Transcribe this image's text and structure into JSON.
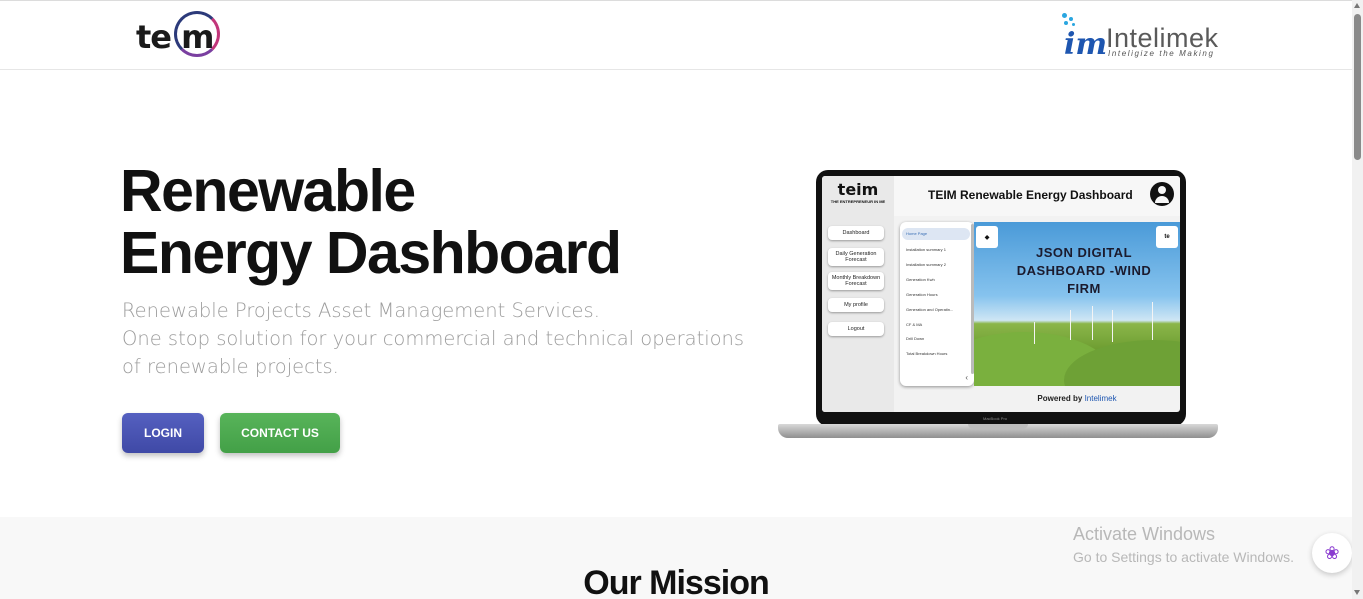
{
  "header": {
    "teim_logo_text": "te m",
    "intelimek": {
      "mark": "im",
      "name": "Intelimek",
      "tagline": "Inteligize the Making"
    }
  },
  "hero": {
    "title_line1": "Renewable",
    "title_line2": "Energy Dashboard",
    "subtitle_line1": "Renewable Projects Asset Management Services.",
    "subtitle_line2": "One stop solution for your commercial and technical operations",
    "subtitle_line3": "of renewable projects.",
    "login_label": "LOGIN",
    "contact_label": "CONTACT US"
  },
  "dashboard_preview": {
    "logo": "teim",
    "logo_sub": "THE ENTREPRENEUR IN ME",
    "title": "TEIM Renewable Energy Dashboard",
    "nav": [
      "Dashboard",
      "Daily Generation Forecast",
      "Monthly Breakdown Forecast",
      "My profile",
      "Logout"
    ],
    "list": [
      "Home Page",
      "Installation summary 1",
      "Installation summary 2",
      "Generation Kwh",
      "Generation Hours",
      "Generation and Operatin...",
      "CF & MA",
      "Drill Down",
      "Total Breakdown Hours"
    ],
    "banner": "JSON DIGITAL DASHBOARD -WIND FIRM",
    "powered_by": "Powered by",
    "powered_brand": "Intelimek",
    "laptop_model": "MacBook Pro"
  },
  "mission": {
    "title": "Our Mission"
  },
  "windows": {
    "line1": "Activate Windows",
    "line2": "Go to Settings to activate Windows."
  },
  "colors": {
    "login": "#3f49a6",
    "contact": "#43a047",
    "accent_blue": "#1e56b0"
  }
}
